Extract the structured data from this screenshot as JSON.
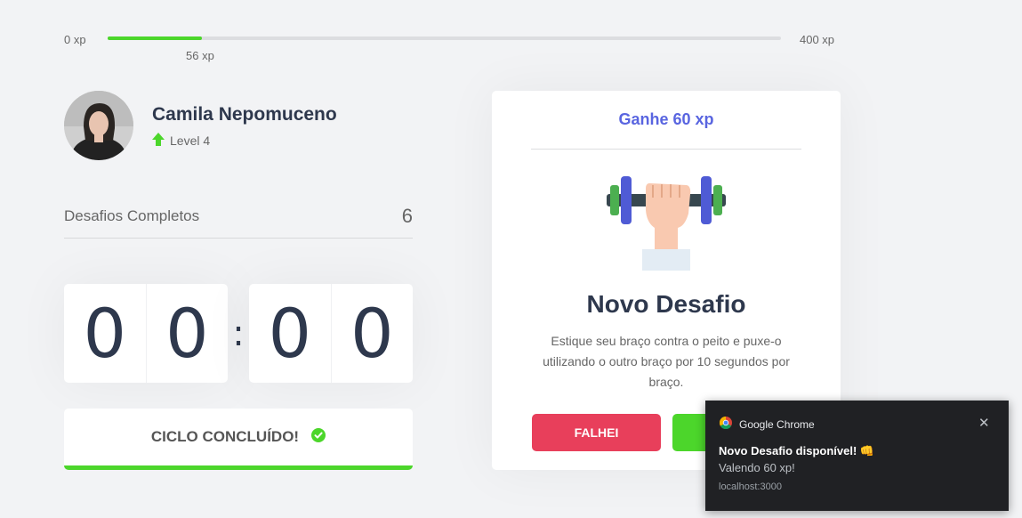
{
  "xp": {
    "min_label": "0 xp",
    "max_label": "400 xp",
    "current_label": "56 xp",
    "current": 56,
    "max": 400,
    "bar_color": "#4cd62b"
  },
  "profile": {
    "name": "Camila Nepomuceno",
    "level_label": "Level 4",
    "level_icon": "level-up-arrow-icon"
  },
  "completed": {
    "label": "Desafios Completos",
    "value": "6"
  },
  "countdown": {
    "minute_left": "0",
    "minute_right": "0",
    "separator": ":",
    "second_left": "0",
    "second_right": "0"
  },
  "cycle_button": {
    "label": "CICLO CONCLUÍDO!",
    "icon": "check-circle-icon",
    "accent": "#4cd62b"
  },
  "challenge": {
    "header": "Ganhe 60 xp",
    "icon": "dumbbell-icon",
    "title": "Novo Desafio",
    "description": "Estique seu braço contra o peito e puxe-o utilizando o outro braço por 10 segundos por braço.",
    "fail_label": "FALHEI",
    "done_label": "C",
    "fail_color": "#e83f5b",
    "done_color": "#4cd62b",
    "header_color": "#5965e0"
  },
  "notification": {
    "app_name": "Google Chrome",
    "title": "Novo Desafio disponível! 👊",
    "body": "Valendo 60 xp!",
    "origin": "localhost:3000",
    "close_icon": "close-icon"
  }
}
